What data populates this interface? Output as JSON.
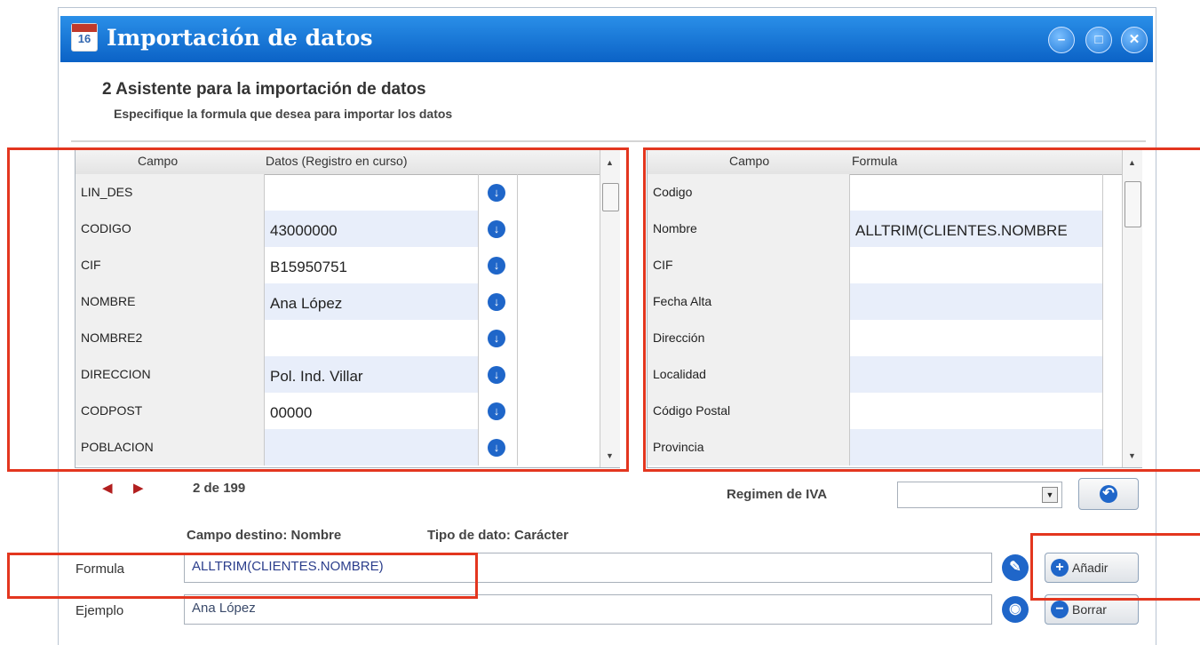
{
  "window": {
    "title": "Importación de datos",
    "app_icon_label": "16"
  },
  "wizard": {
    "step_title": "2 Asistente para la importación de datos",
    "step_subtitle": "Especifique la formula que desea para importar los datos"
  },
  "source_grid": {
    "columns": [
      "Campo",
      "Datos (Registro en curso)"
    ],
    "rows": [
      {
        "campo": "LIN_DES",
        "dato": ""
      },
      {
        "campo": "CODIGO",
        "dato": "43000000"
      },
      {
        "campo": "CIF",
        "dato": "B15950751"
      },
      {
        "campo": "NOMBRE",
        "dato": "Ana López"
      },
      {
        "campo": "NOMBRE2",
        "dato": ""
      },
      {
        "campo": "DIRECCION",
        "dato": "Pol. Ind. Villar"
      },
      {
        "campo": "CODPOST",
        "dato": "00000"
      },
      {
        "campo": "POBLACION",
        "dato": ""
      }
    ]
  },
  "target_grid": {
    "columns": [
      "Campo",
      "Formula"
    ],
    "rows": [
      {
        "campo": "Codigo",
        "formula": ""
      },
      {
        "campo": "Nombre",
        "formula": "ALLTRIM(CLIENTES.NOMBRE"
      },
      {
        "campo": "CIF",
        "formula": ""
      },
      {
        "campo": "Fecha Alta",
        "formula": ""
      },
      {
        "campo": "Dirección",
        "formula": ""
      },
      {
        "campo": "Localidad",
        "formula": ""
      },
      {
        "campo": "Código Postal",
        "formula": ""
      },
      {
        "campo": "Provincia",
        "formula": ""
      }
    ]
  },
  "navigator": {
    "current": "2",
    "of_label": "de",
    "total": "199"
  },
  "regimen_iva": {
    "label": "Regimen de IVA",
    "value": ""
  },
  "target_info": {
    "campo_destino": "Campo destino: Nombre",
    "tipo_dato": "Tipo de dato: Carácter"
  },
  "formula": {
    "label": "Formula",
    "value": "ALLTRIM(CLIENTES.NOMBRE)"
  },
  "ejemplo": {
    "label": "Ejemplo",
    "value": "Ana López"
  },
  "buttons": {
    "add": "Añadir",
    "delete": "Borrar"
  },
  "colors": {
    "title_bar": "#0b62c6",
    "highlight": "#e3361f",
    "row_alt": "#e8eefa",
    "accent": "#1f66c9"
  }
}
